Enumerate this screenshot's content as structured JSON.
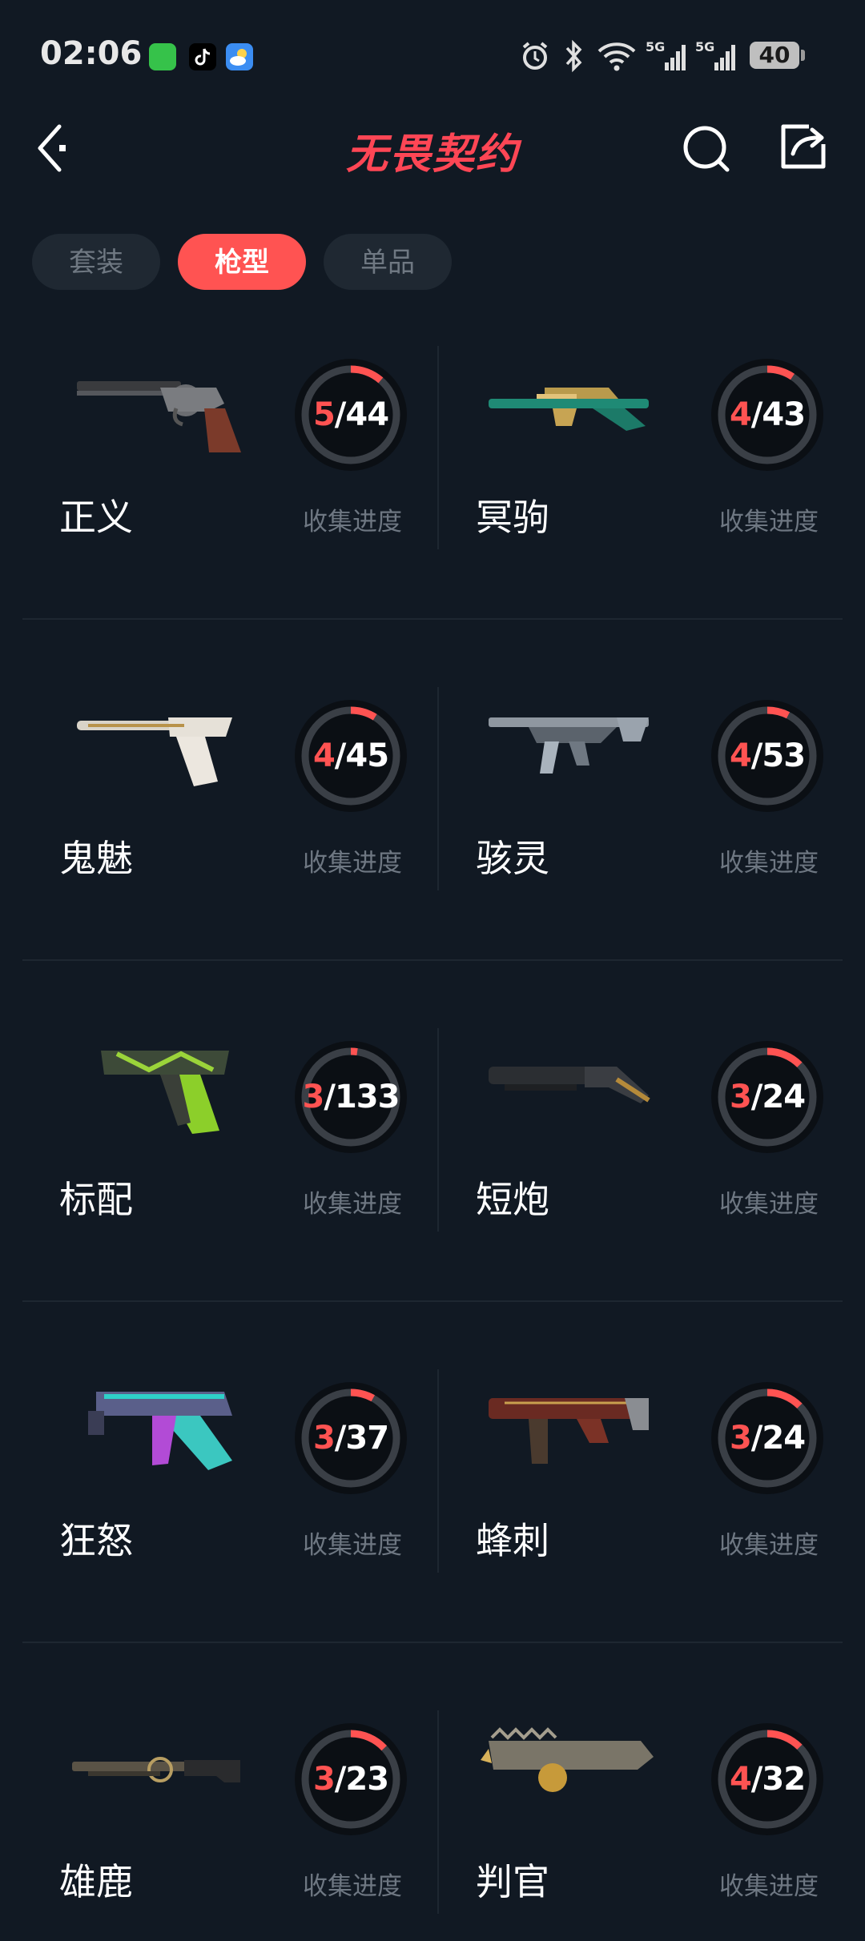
{
  "status_bar": {
    "time": "02:06",
    "battery": "40",
    "icons": [
      "message-app-icon",
      "tiktok-icon",
      "weather-app-icon",
      "alarm-icon",
      "bluetooth-icon",
      "wifi-icon",
      "signal-5g-icon",
      "signal-5g-icon"
    ]
  },
  "header": {
    "title": "无畏契约",
    "back_icon": "chevron-left-icon",
    "search_icon": "search-icon",
    "share_icon": "share-icon"
  },
  "tabs": [
    {
      "label": "套装",
      "active": false
    },
    {
      "label": "枪型",
      "active": true
    },
    {
      "label": "单品",
      "active": false
    }
  ],
  "progress_label": "收集进度",
  "colors": {
    "accent": "#ff5352",
    "title": "#ff4655",
    "background": "#111923"
  },
  "weapons": [
    {
      "name": "正义",
      "collected": "5",
      "total": "44",
      "progress": 0.1136
    },
    {
      "name": "冥驹",
      "collected": "4",
      "total": "43",
      "progress": 0.093
    },
    {
      "name": "鬼魅",
      "collected": "4",
      "total": "45",
      "progress": 0.0889
    },
    {
      "name": "骇灵",
      "collected": "4",
      "total": "53",
      "progress": 0.0755
    },
    {
      "name": "标配",
      "collected": "3",
      "total": "133",
      "progress": 0.0226
    },
    {
      "name": "短炮",
      "collected": "3",
      "total": "24",
      "progress": 0.125
    },
    {
      "name": "狂怒",
      "collected": "3",
      "total": "37",
      "progress": 0.0811
    },
    {
      "name": "蜂刺",
      "collected": "3",
      "total": "24",
      "progress": 0.125
    },
    {
      "name": "雄鹿",
      "collected": "3",
      "total": "23",
      "progress": 0.1304
    },
    {
      "name": "判官",
      "collected": "4",
      "total": "32",
      "progress": 0.125
    }
  ]
}
